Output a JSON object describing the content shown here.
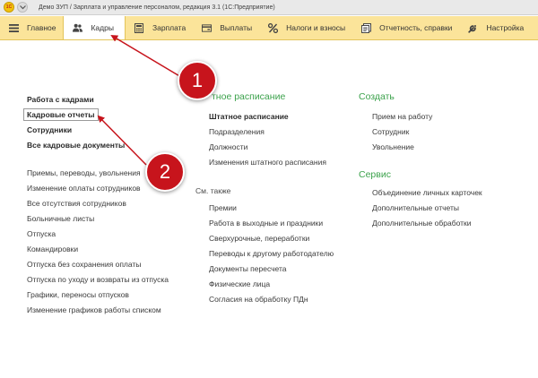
{
  "window": {
    "app_icon_text": "1С",
    "title": "Демо ЗУП / Зарплата и управление персоналом, редакция 3.1  (1С:Предприятие)"
  },
  "sections": [
    {
      "label": "Главное",
      "icon": "hamburger-icon"
    },
    {
      "label": "Кадры",
      "icon": "people-icon"
    },
    {
      "label": "Зарплата",
      "icon": "calculator-icon"
    },
    {
      "label": "Выплаты",
      "icon": "wallet-icon"
    },
    {
      "label": "Налоги и взносы",
      "icon": "percent-icon"
    },
    {
      "label": "Отчетность, справки",
      "icon": "documents-icon"
    },
    {
      "label": "Настройка",
      "icon": "wrench-icon"
    }
  ],
  "active_section": "Кадры",
  "left_column": {
    "bold_links": [
      "Работа с кадрами",
      "Кадровые отчеты",
      "Сотрудники",
      "Все кадровые документы"
    ],
    "links": [
      "Приемы, переводы, увольнения",
      "Изменение оплаты сотрудников",
      "Все отсутствия сотрудников",
      "Больничные листы",
      "Отпуска",
      "Командировки",
      "Отпуска без сохранения оплаты",
      "Отпуска по уходу и возвраты из отпуска",
      "Графики, переносы отпусков",
      "Изменение графиков работы списком"
    ]
  },
  "middle_column": {
    "group_title": "тное расписание",
    "bold_link": "Штатное расписание",
    "links": [
      "Подразделения",
      "Должности",
      "Изменения штатного расписания"
    ],
    "see_also_title": "См. также",
    "see_also_links": [
      "Премии",
      "Работа в выходные и праздники",
      "Сверхурочные, переработки",
      "Переводы к другому работодателю",
      "Документы пересчета",
      "Физические лица",
      "Согласия на обработку ПДн"
    ]
  },
  "right_column": {
    "create_title": "Создать",
    "create_links": [
      "Прием на работу",
      "Сотрудник",
      "Увольнение"
    ],
    "service_title": "Сервис",
    "service_links": [
      "Объединение личных карточек",
      "Дополнительные отчеты",
      "Дополнительные обработки"
    ]
  },
  "annotations": {
    "marker_1": "1",
    "marker_2": "2",
    "color": "#c7141c"
  },
  "colors": {
    "section_bar": "#fbe49a",
    "group_title": "#3ca24c"
  }
}
